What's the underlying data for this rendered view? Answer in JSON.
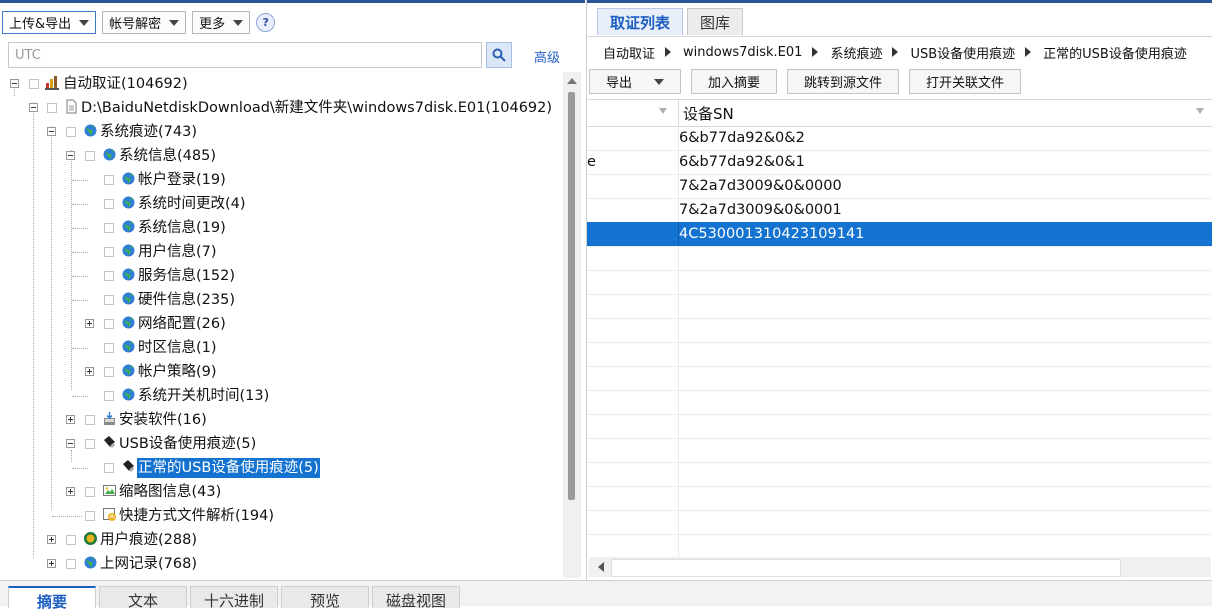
{
  "toolbar": {
    "upload_export": "上传&导出",
    "account_decrypt": "帐号解密",
    "more": "更多",
    "help": "?"
  },
  "search": {
    "placeholder": "UTC",
    "advanced": "高级"
  },
  "tree": {
    "root": "自动取证(104692)",
    "disk": "D:\\BaiduNetdiskDownload\\新建文件夹\\windows7disk.E01(104692)",
    "system_traces": "系统痕迹(743)",
    "system_info": "系统信息(485)",
    "children": [
      "帐户登录(19)",
      "系统时间更改(4)",
      "系统信息(19)",
      "用户信息(7)",
      "服务信息(152)",
      "硬件信息(235)",
      "网络配置(26)",
      "时区信息(1)",
      "帐户策略(9)",
      "系统开关机时间(13)"
    ],
    "installed_software": "安装软件(16)",
    "usb_traces": "USB设备使用痕迹(5)",
    "usb_normal": "正常的USB设备使用痕迹(5)",
    "thumbnail": "缩略图信息(43)",
    "shortcut": "快捷方式文件解析(194)",
    "user_traces": "用户痕迹(288)",
    "web_history": "上网记录(768)"
  },
  "right": {
    "tabs": [
      "取证列表",
      "图库"
    ],
    "breadcrumb": [
      "自动取证",
      "windows7disk.E01",
      "系统痕迹",
      "USB设备使用痕迹",
      "正常的USB设备使用痕迹"
    ],
    "buttons": {
      "export": "导出",
      "add_summary": "加入摘要",
      "jump_source": "跳转到源文件",
      "open_related": "打开关联文件"
    },
    "grid": {
      "column": "设备SN",
      "rows": [
        {
          "c1": "",
          "sn": "6&b77da92&0&2"
        },
        {
          "c1": "e",
          "sn": "6&b77da92&0&1"
        },
        {
          "c1": "",
          "sn": "7&2a7d3009&0&0000"
        },
        {
          "c1": "",
          "sn": "7&2a7d3009&0&0001"
        },
        {
          "c1": "",
          "sn": "4C530001310423109141"
        }
      ],
      "selected_row": 4
    }
  },
  "bottom_tabs": [
    "摘要",
    "文本",
    "十六进制",
    "预览",
    "磁盘视图"
  ],
  "colors": {
    "accent": "#1473d0",
    "tab_text": "#1c5ec2"
  }
}
